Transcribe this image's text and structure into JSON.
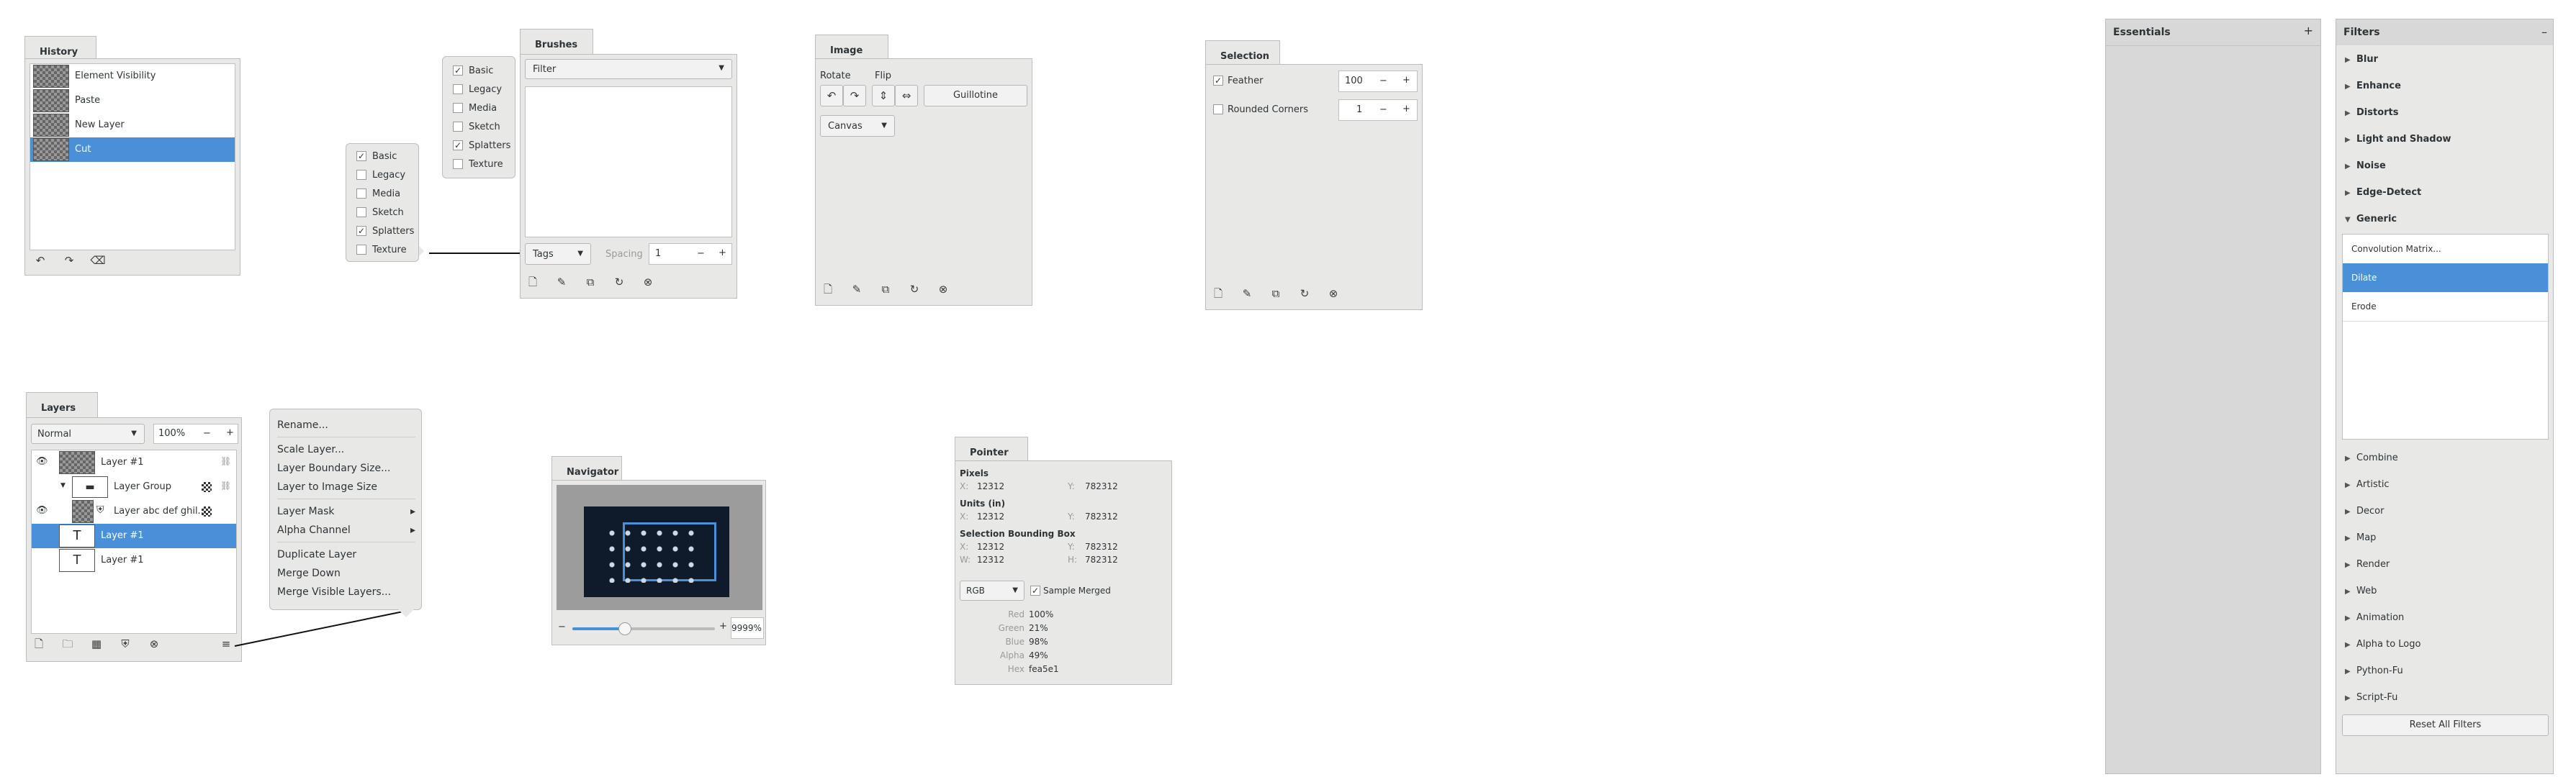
{
  "history": {
    "tab": "History",
    "items": [
      "Element Visibility",
      "Paste",
      "New Layer",
      "Cut"
    ],
    "selected_index": 3,
    "footer_icons": [
      "undo-icon",
      "redo-icon",
      "clear-icon"
    ]
  },
  "tags_popover_small": {
    "items": [
      {
        "label": "Basic",
        "checked": true
      },
      {
        "label": "Legacy",
        "checked": false
      },
      {
        "label": "Media",
        "checked": false
      },
      {
        "label": "Sketch",
        "checked": false
      },
      {
        "label": "Splatters",
        "checked": true
      },
      {
        "label": "Texture",
        "checked": false
      }
    ]
  },
  "brushes": {
    "tab": "Brushes",
    "filter_label": "Filter",
    "tags_label": "Tags",
    "spacing_label": "Spacing",
    "spacing_value": "1",
    "minus": "−",
    "plus": "+",
    "tag_items": [
      {
        "label": "Basic",
        "checked": true
      },
      {
        "label": "Legacy",
        "checked": false
      },
      {
        "label": "Media",
        "checked": false
      },
      {
        "label": "Sketch",
        "checked": false
      },
      {
        "label": "Splatters",
        "checked": true
      },
      {
        "label": "Texture",
        "checked": false
      }
    ]
  },
  "image": {
    "tab": "Image",
    "rotate_label": "Rotate",
    "flip_label": "Flip",
    "guillotine_label": "Guillotine",
    "canvas_label": "Canvas"
  },
  "selection": {
    "tab": "Selection",
    "feather_label": "Feather",
    "feather_checked": true,
    "feather_value": "100",
    "rounded_label": "Rounded Corners",
    "rounded_checked": false,
    "rounded_value": "1",
    "minus": "−",
    "plus": "+"
  },
  "essentials": {
    "title": "Essentials",
    "plus": "+"
  },
  "filters": {
    "title": "Filters",
    "collapse": "–",
    "groups_top": [
      "Blur",
      "Enhance",
      "Distorts",
      "Light and Shadow",
      "Noise",
      "Edge-Detect"
    ],
    "expanded_group": "Generic",
    "generic_items": [
      "Convolution Matrix...",
      "Dilate",
      "Erode"
    ],
    "generic_selected": 1,
    "groups_bottom": [
      "Combine",
      "Artistic",
      "Decor",
      "Map",
      "Render",
      "Web",
      "Animation",
      "Alpha to Logo",
      "Python-Fu",
      "Script-Fu"
    ],
    "reset_label": "Reset All Filters"
  },
  "layers": {
    "tab": "Layers",
    "mode": "Normal",
    "opacity": "100%",
    "minus": "−",
    "plus": "+",
    "items": [
      {
        "name": "Layer #1"
      },
      {
        "name": "Layer Group"
      },
      {
        "name": "Layer abc def ghil..."
      },
      {
        "name": "Layer #1"
      },
      {
        "name": "Layer #1"
      }
    ],
    "selected_index": 3,
    "text_glyph": "T",
    "menu_glyph": "≡"
  },
  "layer_menu": {
    "items": [
      "Rename...",
      "Scale Layer...",
      "Layer Boundary Size...",
      "Layer to Image Size",
      "Layer Mask",
      "Alpha Channel",
      "Duplicate Layer",
      "Merge Down",
      "Merge Visible Layers..."
    ],
    "submenu_arrow": "▸"
  },
  "navigator": {
    "tab": "Navigator",
    "zoom_value": "9999%",
    "zoom_level": 0.34,
    "minus": "−",
    "plus": "+"
  },
  "pointer": {
    "tab": "Pointer",
    "pixels_label": "Pixels",
    "units_label": "Units (in)",
    "bbox_label": "Selection Bounding Box",
    "x_label": "X:",
    "y_label": "Y:",
    "w_label": "W:",
    "h_label": "H:",
    "pixels_x": "12312",
    "pixels_y": "782312",
    "units_x": "12312",
    "units_y": "782312",
    "bbox_x": "12312",
    "bbox_y": "782312",
    "bbox_w": "12312",
    "bbox_h": "782312",
    "color_mode": "RGB",
    "sample_merged_label": "Sample Merged",
    "sample_merged_checked": true,
    "red_label": "Red",
    "red_value": "100%",
    "green_label": "Green",
    "green_value": "21%",
    "blue_label": "Blue",
    "blue_value": "98%",
    "alpha_label": "Alpha",
    "alpha_value": "49%",
    "hex_label": "Hex",
    "hex_value": "fea5e1"
  },
  "colors": {
    "panel_bg": "#e8e8e7",
    "selection": "#4a90d9",
    "border": "#bdbdbd",
    "sidebar_bg": "#d8d8d8"
  }
}
